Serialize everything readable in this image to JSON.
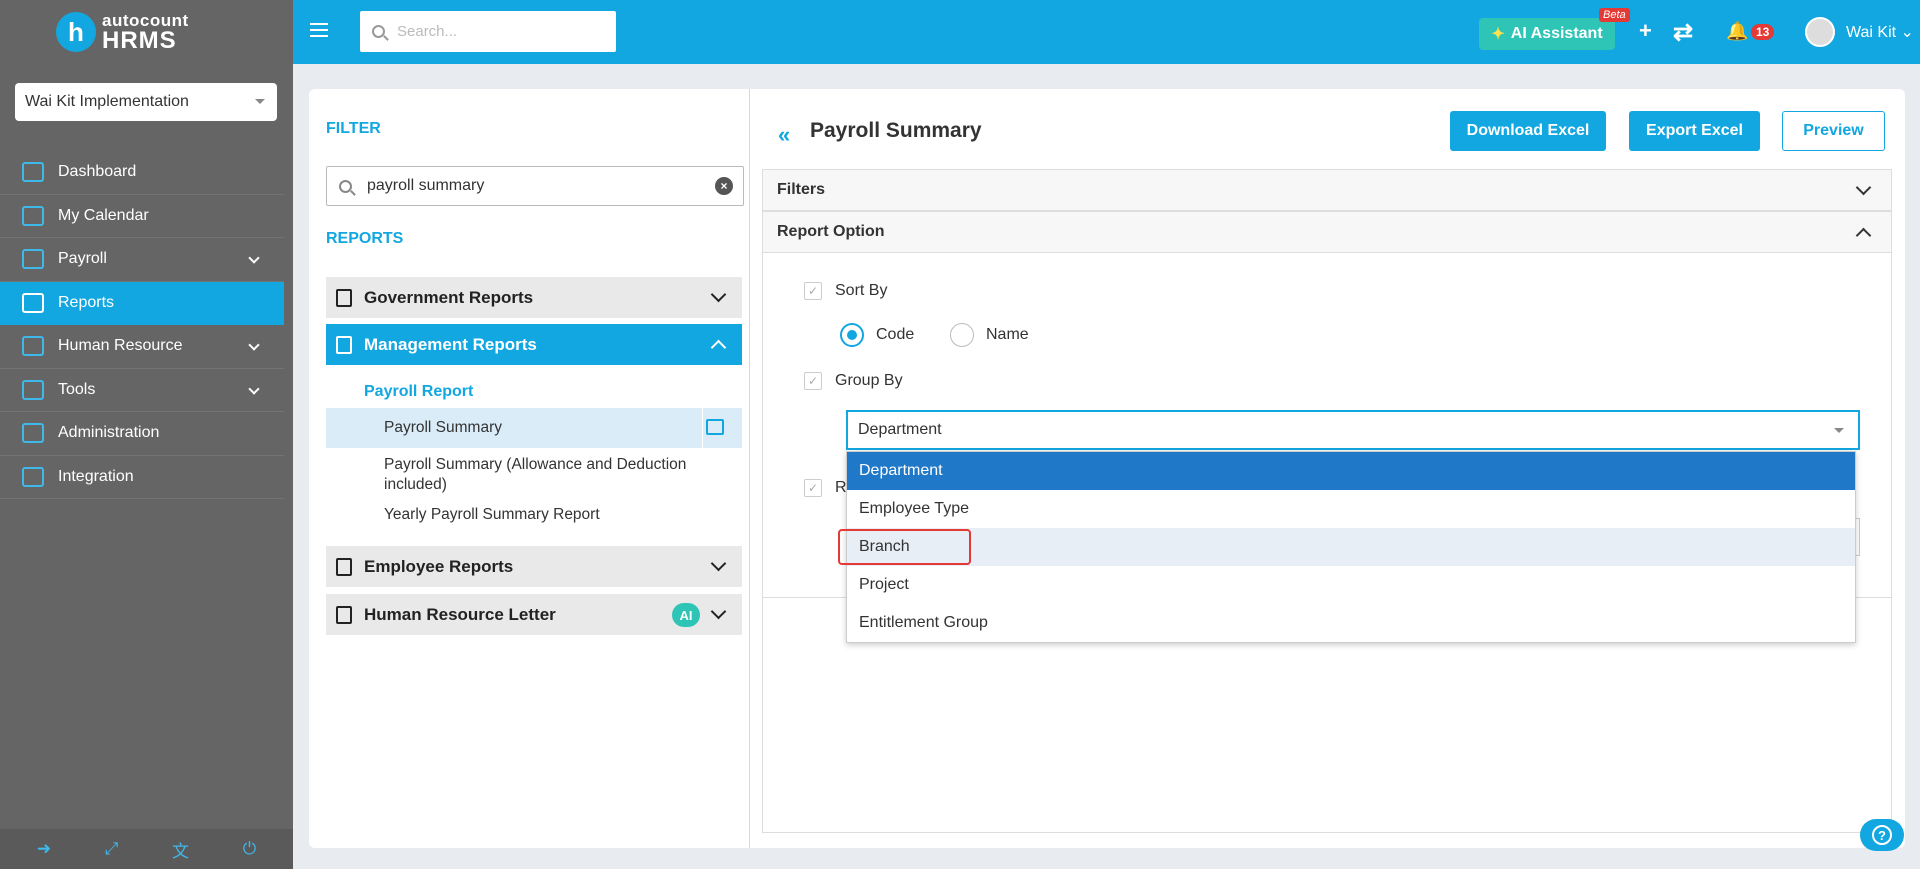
{
  "brand": {
    "logo_letter": "h",
    "name": "autocount",
    "product": "HRMS"
  },
  "company": {
    "selected": "Wai Kit Implementation"
  },
  "nav": {
    "items": [
      {
        "label": "Dashboard"
      },
      {
        "label": "My Calendar"
      },
      {
        "label": "Payroll"
      },
      {
        "label": "Reports"
      },
      {
        "label": "Human Resource"
      },
      {
        "label": "Tools"
      },
      {
        "label": "Administration"
      },
      {
        "label": "Integration"
      }
    ]
  },
  "footer_icons": [
    "logout-icon",
    "fullscreen-icon",
    "language-icon",
    "power-icon"
  ],
  "topbar": {
    "search_placeholder": "Search...",
    "ai_label": "AI Assistant",
    "beta": "Beta",
    "notifications": "13",
    "username": "Wai Kit"
  },
  "left": {
    "filter_title": "FILTER",
    "filter_value": "payroll summary",
    "reports_title": "REPORTS",
    "groups": [
      "Government Reports",
      "Management Reports",
      "Employee Reports",
      "Human Resource Letter"
    ],
    "ai_badge": "AI",
    "sub_heading": "Payroll Report",
    "items": [
      "Payroll Summary",
      "Payroll Summary (Allowance and Deduction included)",
      "Yearly Payroll Summary Report"
    ]
  },
  "right": {
    "title": "Payroll Summary",
    "buttons": {
      "download": "Download Excel",
      "export": "Export Excel",
      "preview": "Preview"
    },
    "filters_label": "Filters",
    "report_option_label": "Report Option",
    "sort_by": "Sort By",
    "radio_code": "Code",
    "radio_name": "Name",
    "group_by": "Group By",
    "third_label_partial": "R",
    "group_by_value": "Department",
    "options": [
      "Department",
      "Employee Type",
      "Branch",
      "Project",
      "Entitlement Group"
    ]
  },
  "colors": {
    "accent": "#12a7e0",
    "sidebar": "#656565",
    "selected_option": "#1f78c8",
    "highlight": "#e53935",
    "ai": "#2ec4b6"
  }
}
